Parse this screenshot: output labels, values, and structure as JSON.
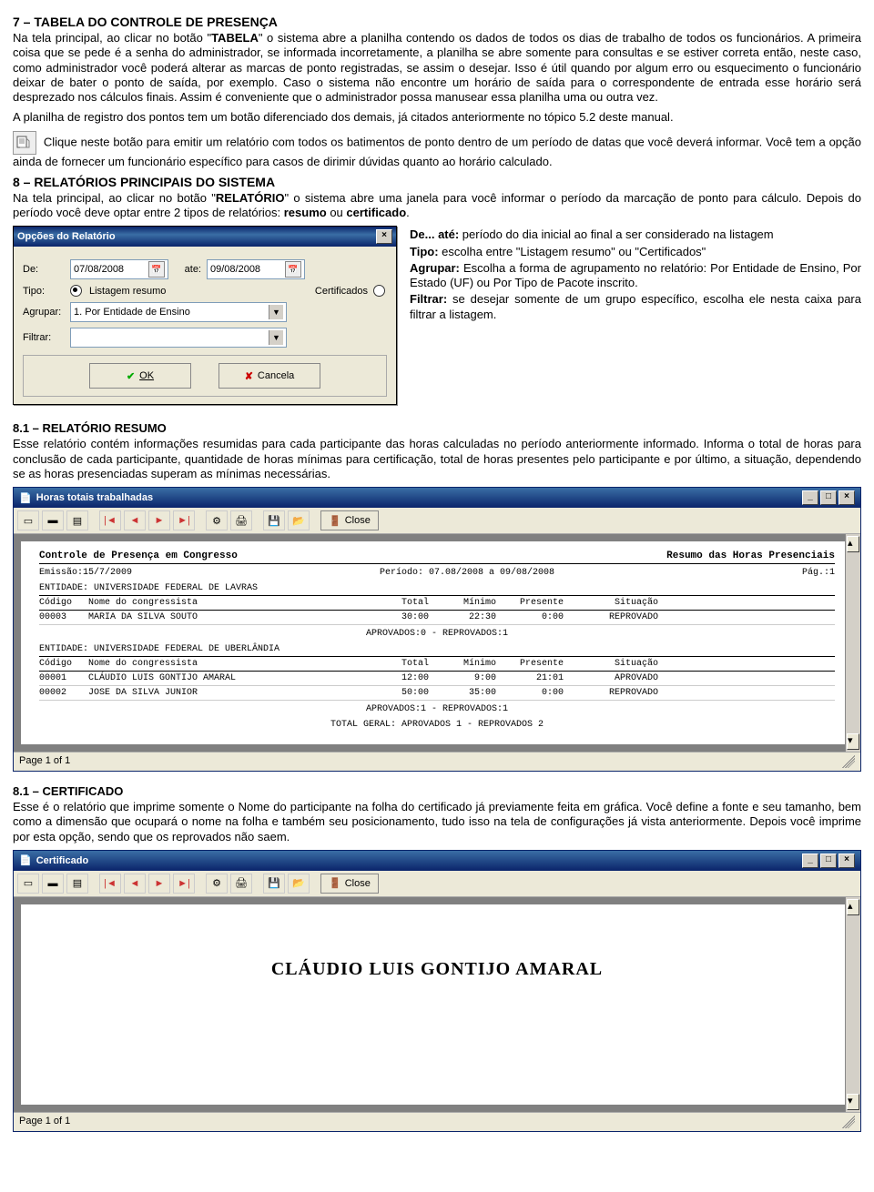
{
  "section7": {
    "title": "7 – TABELA DO CONTROLE DE PRESENÇA",
    "p1a": "Na tela principal, ao clicar no botão \"",
    "p1b": "TABELA",
    "p1c": "\" o sistema abre a planilha contendo os dados de todos os dias de trabalho de todos os funcionários. A primeira coisa que se pede é a senha do administrador, se informada incorretamente, a planilha se abre somente para consultas e se estiver correta então, neste caso, como administrador você poderá alterar as marcas de ponto registradas, se assim o desejar. Isso é útil quando por algum erro ou esquecimento o funcionário deixar de bater o ponto de saída, por exemplo. Caso o sistema não encontre um horário de saída para o correspondente de entrada esse horário será desprezado nos cálculos finais. Assim é conveniente que o administrador possa manusear essa planilha uma ou outra vez.",
    "p2": "A planilha de registro dos pontos tem um botão diferenciado dos demais, já citados anteriormente no tópico 5.2 deste manual.",
    "p3": " Clique neste botão para emitir um relatório com todos os batimentos de ponto dentro de um período de datas que você deverá informar. Você tem a opção ainda de fornecer um funcionário específico para casos de dirimir dúvidas quanto ao horário calculado."
  },
  "section8": {
    "title": "8 – RELATÓRIOS PRINCIPAIS DO SISTEMA",
    "p1a": "Na tela principal, ao clicar no botão \"",
    "p1b": "RELATÓRIO",
    "p1c": "\" o sistema abre uma janela para você informar o período da marcação de ponto para cálculo. Depois do período você deve optar entre 2 tipos de relatórios: ",
    "p1d": "resumo",
    "p1e": " ou ",
    "p1f": "certificado",
    "p1g": ".",
    "desc": {
      "de_b": "De... até:",
      "de": " período do dia inicial ao final a ser considerado na listagem",
      "tipo_b": "Tipo:",
      "tipo": " escolha entre \"Listagem resumo\" ou \"Certificados\"",
      "agr_b": "Agrupar:",
      "agr": " Escolha a forma de agrupamento no relatório: Por Entidade de Ensino, Por Estado (UF) ou Por Tipo de Pacote inscrito.",
      "fil_b": "Filtrar:",
      "fil": " se desejar somente de um grupo específico, escolha ele nesta caixa para filtrar a listagem."
    }
  },
  "dialog": {
    "title": "Opções do Relatório",
    "de_label": "De:",
    "de_value": "07/08/2008",
    "ate_label": "ate:",
    "ate_value": "09/08/2008",
    "tipo_label": "Tipo:",
    "opt1": "Listagem resumo",
    "opt2": "Certificados",
    "agrupar_label": "Agrupar:",
    "agrupar_value": "1. Por Entidade de Ensino",
    "filtrar_label": "Filtrar:",
    "filtrar_value": "",
    "ok": "OK",
    "cancel": "Cancela"
  },
  "section81": {
    "title": "8.1 – RELATÓRIO RESUMO",
    "p": "Esse relatório contém informações resumidas para cada participante das horas calculadas no período anteriormente informado. Informa o total de horas para conclusão de cada participante, quantidade de horas mínimas para certificação, total de horas presentes pelo participante e por último, a situação, dependendo se as horas presenciadas superam as mínimas necessárias."
  },
  "report1": {
    "win_title": "Horas totais trabalhadas",
    "close": "Close",
    "header_left": "Controle de Presença em Congresso",
    "header_right": "Resumo das Horas Presenciais",
    "emissao": "Emissão:15/7/2009",
    "periodo": "Período: 07.08/2008 a 09/08/2008",
    "pag": "Pág.:1",
    "col": {
      "cod": "Código",
      "nome": "Nome do congressista",
      "total": "Total",
      "min": "Mínimo",
      "pres": "Presente",
      "sit": "Situação"
    },
    "ent1": "ENTIDADE: UNIVERSIDADE FEDERAL DE LAVRAS",
    "rows1": [
      {
        "cod": "00003",
        "nome": "MARIA DA SILVA SOUTO",
        "total": "30:00",
        "min": "22:30",
        "pres": "0:00",
        "sit": "REPROVADO"
      }
    ],
    "sum1": "APROVADOS:0  -  REPROVADOS:1",
    "ent2": "ENTIDADE: UNIVERSIDADE FEDERAL DE UBERLÂNDIA",
    "rows2": [
      {
        "cod": "00001",
        "nome": "CLÁUDIO LUIS GONTIJO AMARAL",
        "total": "12:00",
        "min": "9:00",
        "pres": "21:01",
        "sit": "APROVADO"
      },
      {
        "cod": "00002",
        "nome": "JOSE DA SILVA JUNIOR",
        "total": "50:00",
        "min": "35:00",
        "pres": "0:00",
        "sit": "REPROVADO"
      }
    ],
    "sum2": "APROVADOS:1  -  REPROVADOS:1",
    "total_geral": "TOTAL GERAL: APROVADOS 1  -  REPROVADOS 2",
    "status": "Page 1 of 1"
  },
  "section82": {
    "title": "8.1 – CERTIFICADO",
    "p": "Esse é o relatório que imprime somente o Nome do participante na folha do certificado já previamente feita em gráfica. Você define a fonte e seu tamanho, bem como a dimensão que ocupará o nome na folha e também seu posicionamento, tudo isso na tela de configurações já vista anteriormente. Depois você imprime por esta opção, sendo que os reprovados não saem."
  },
  "report2": {
    "win_title": "Certificado",
    "close": "Close",
    "name": "CLÁUDIO LUIS GONTIJO AMARAL",
    "status": "Page 1 of 1"
  }
}
